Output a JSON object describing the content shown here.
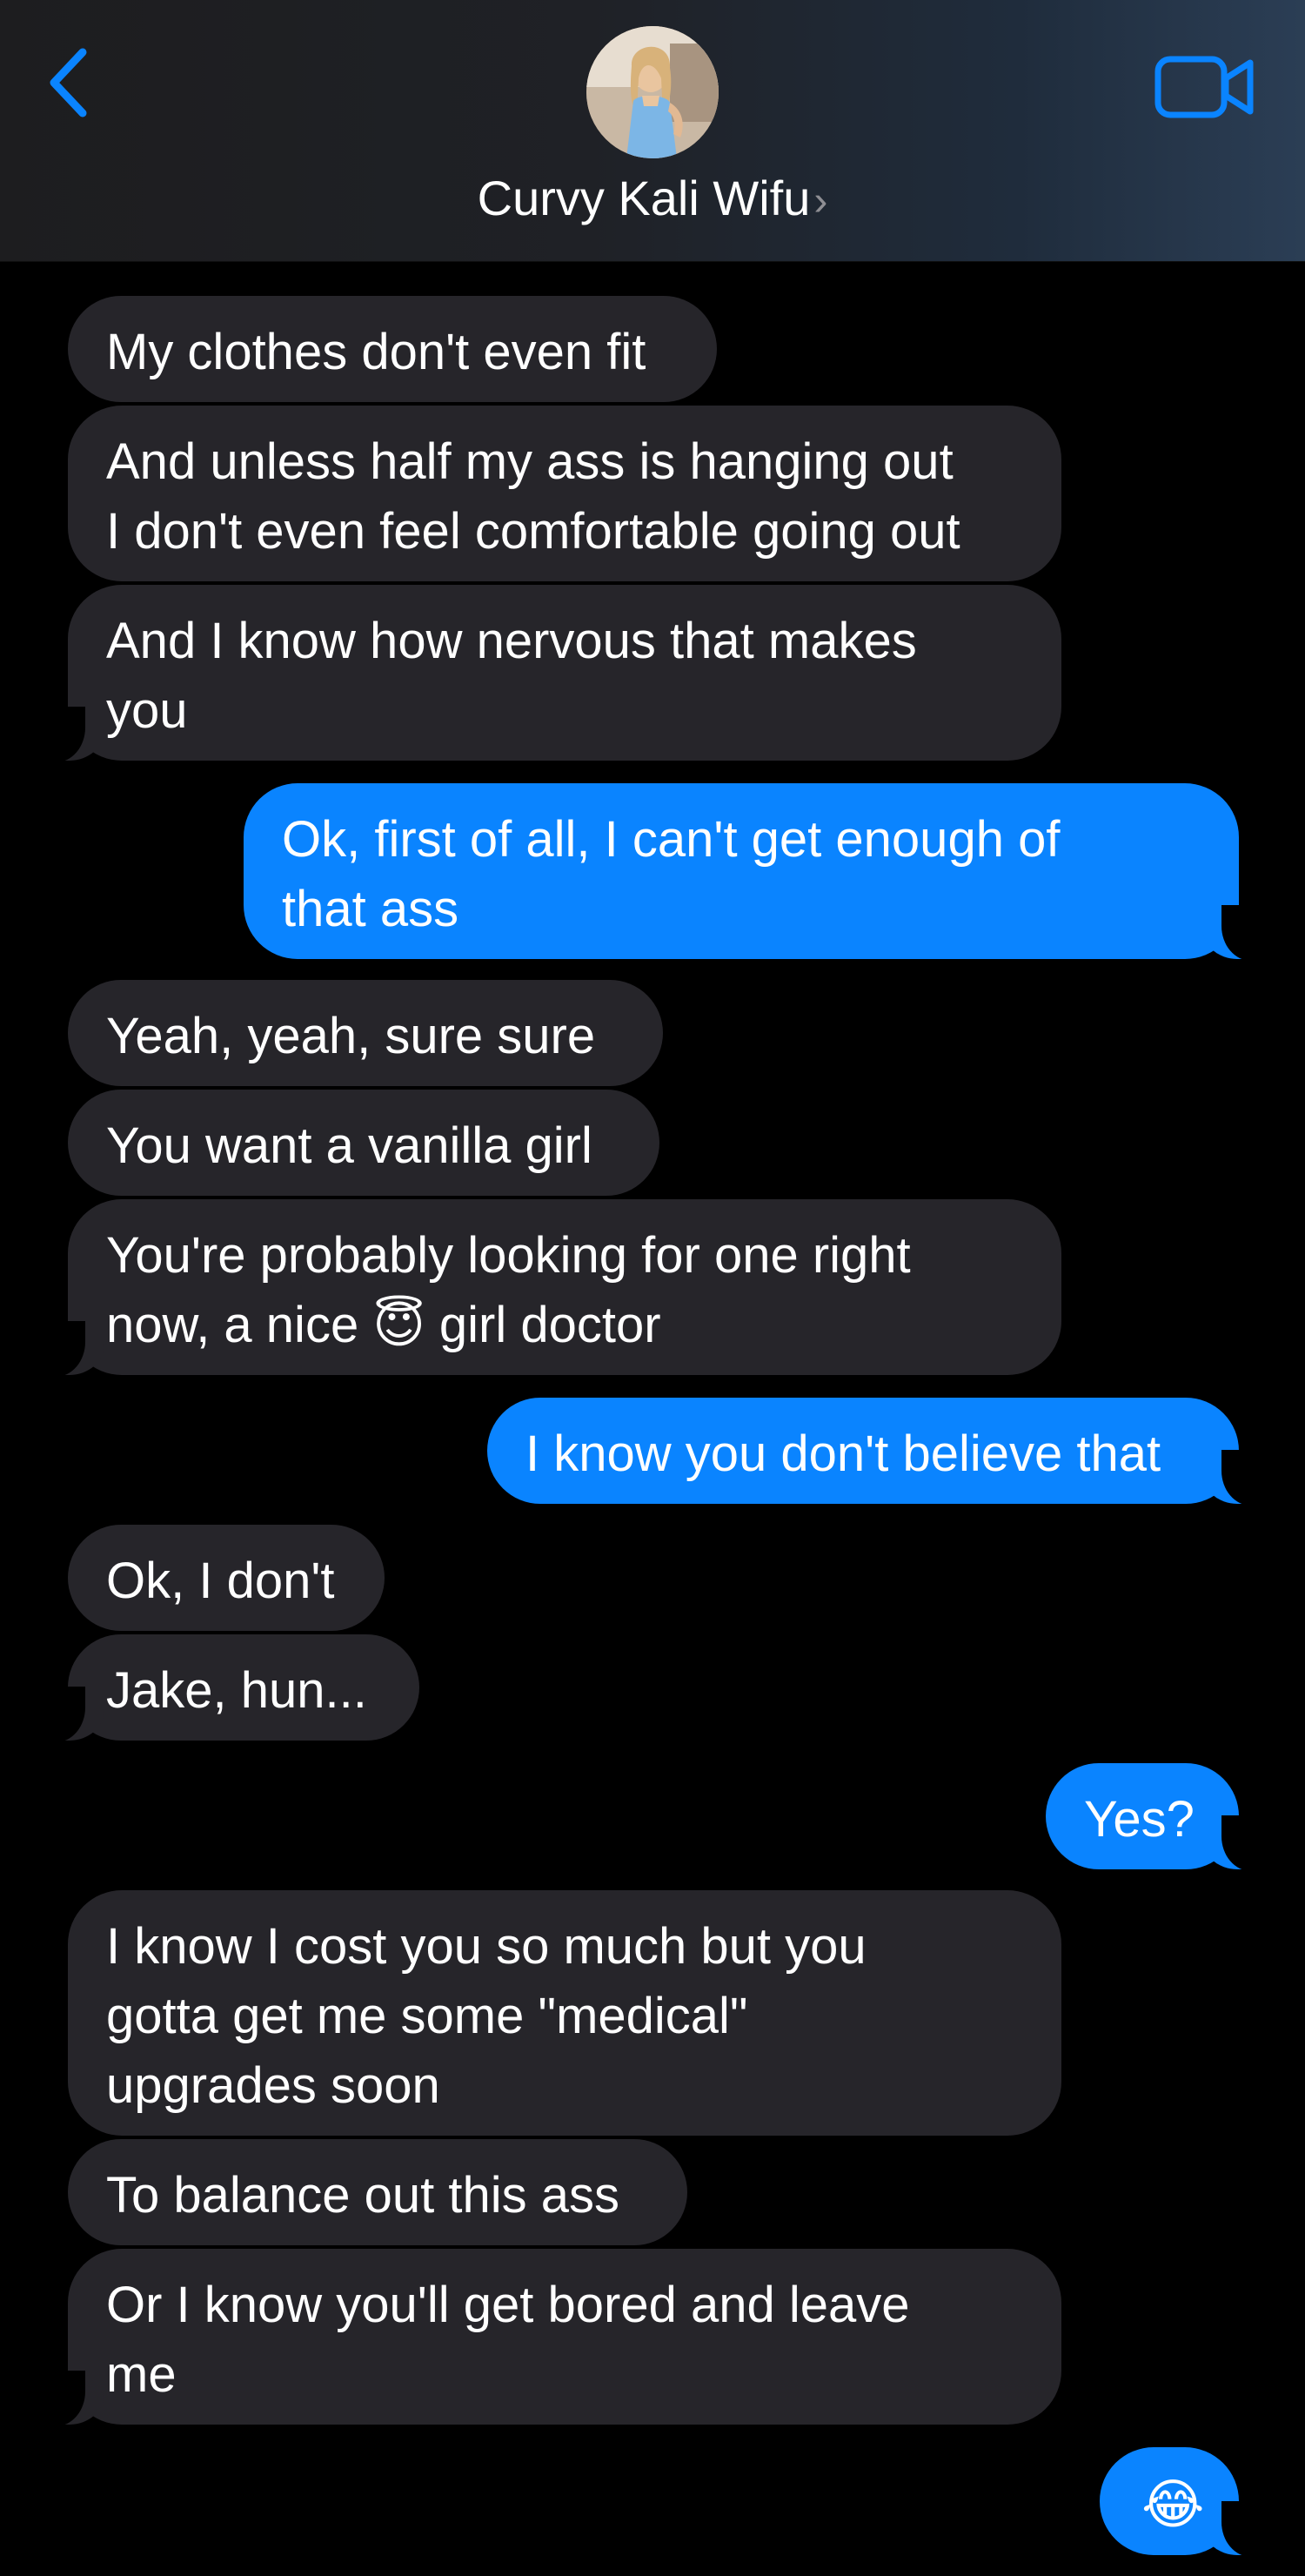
{
  "header": {
    "contact_name": "Curvy Kali Wifu",
    "chevron": "›",
    "back_icon": "chevron-left-icon",
    "video_icon": "video-camera-icon",
    "accent_color": "#0a84ff"
  },
  "messages": [
    {
      "from": "them",
      "lines": [
        "My clothes don't even fit"
      ]
    },
    {
      "from": "them",
      "lines": [
        "And unless half my ass is hanging out",
        "I don't even feel comfortable going out"
      ]
    },
    {
      "from": "them",
      "lines": [
        "And I know how nervous that makes",
        "you"
      ]
    },
    {
      "from": "me",
      "lines": [
        "Ok, first of all, I can't get enough of",
        "that ass"
      ]
    },
    {
      "from": "them",
      "lines": [
        "Yeah, yeah, sure sure"
      ]
    },
    {
      "from": "them",
      "lines": [
        "You want a vanilla girl"
      ]
    },
    {
      "from": "them",
      "lines": [
        "You're probably looking for one right",
        "now, a nice 😇 girl doctor"
      ]
    },
    {
      "from": "me",
      "lines": [
        "I know you don't believe that"
      ]
    },
    {
      "from": "them",
      "lines": [
        "Ok, I don't"
      ]
    },
    {
      "from": "them",
      "lines": [
        "Jake, hun..."
      ]
    },
    {
      "from": "me",
      "lines": [
        "Yes?"
      ]
    },
    {
      "from": "them",
      "lines": [
        "I know I cost you so much but you",
        "gotta get me some \"medical\"",
        "upgrades soon"
      ]
    },
    {
      "from": "them",
      "lines": [
        "To balance out this ass"
      ]
    },
    {
      "from": "them",
      "lines": [
        "Or I know you'll get bored and leave",
        "me"
      ]
    },
    {
      "from": "me",
      "lines": [
        "😂"
      ]
    }
  ]
}
